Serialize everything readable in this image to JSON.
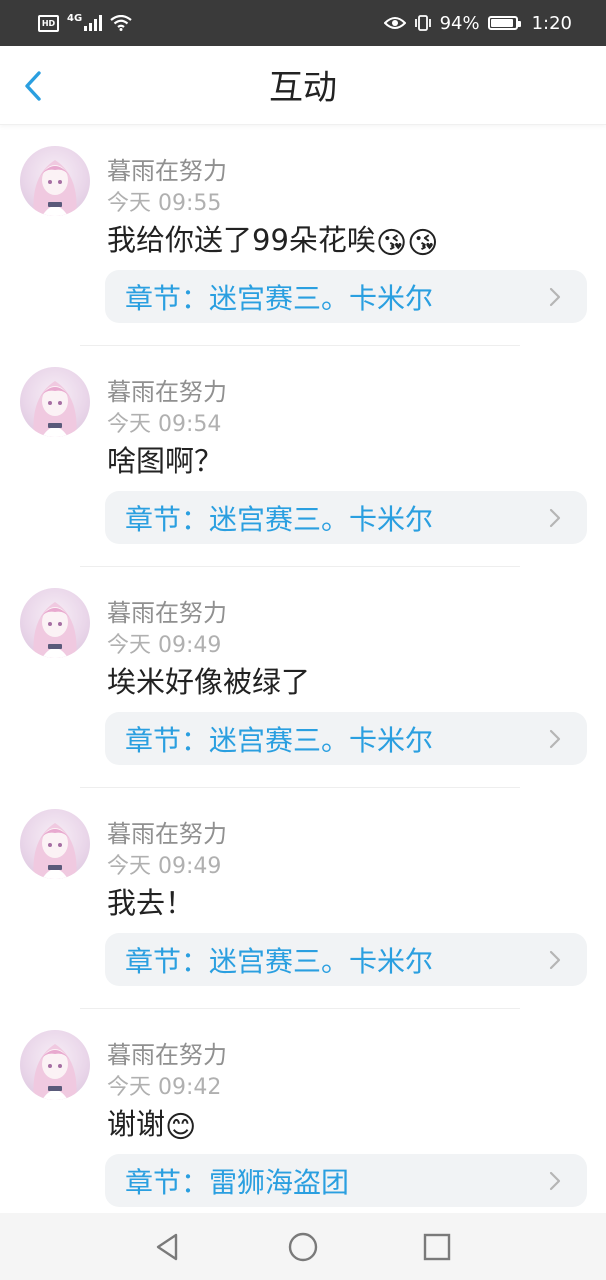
{
  "status_bar": {
    "hd": "HD",
    "network": "4G",
    "battery_percent": "94%",
    "time": "1:20"
  },
  "header": {
    "title": "互动"
  },
  "colors": {
    "accent": "#2a9fe0",
    "status_bar_bg": "#3a3a3a",
    "chapter_bg": "#f1f3f5"
  },
  "items": [
    {
      "user": "暮雨在努力",
      "time": "今天 09:55",
      "text": "我给你送了99朵花唉",
      "emojis": "😘😘",
      "chapter": "章节：迷宫赛三。卡米尔"
    },
    {
      "user": "暮雨在努力",
      "time": "今天 09:54",
      "text": "啥图啊？",
      "emojis": "",
      "chapter": "章节：迷宫赛三。卡米尔"
    },
    {
      "user": "暮雨在努力",
      "time": "今天 09:49",
      "text": "埃米好像被绿了",
      "emojis": "",
      "chapter": "章节：迷宫赛三。卡米尔"
    },
    {
      "user": "暮雨在努力",
      "time": "今天 09:49",
      "text": "我去！",
      "emojis": "",
      "chapter": "章节：迷宫赛三。卡米尔"
    },
    {
      "user": "暮雨在努力",
      "time": "今天 09:42",
      "text": "谢谢",
      "emojis": "😊",
      "chapter": "章节：雷狮海盗团"
    }
  ]
}
